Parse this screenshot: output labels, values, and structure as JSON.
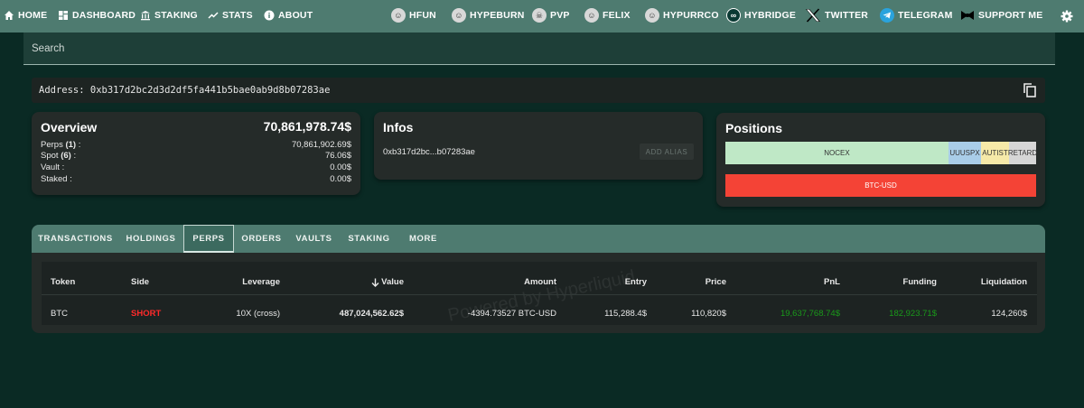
{
  "nav": {
    "home": "HOME",
    "dashboard": "DASHBOARD",
    "staking": "STAKING",
    "stats": "STATS",
    "about": "ABOUT",
    "hfun": "HFUN",
    "hypeburn": "HYPEBURN",
    "pvp": "PVP",
    "felix": "FELIX",
    "hypurrco": "HYPURRCO",
    "hybridge": "HYBRIDGE",
    "twitter": "TWITTER",
    "telegram": "TELEGRAM",
    "support": "SUPPORT ME"
  },
  "search": {
    "placeholder": "Search"
  },
  "address": {
    "text": "Address: 0xb317d2bc2d3d2df5fa441b5bae0ab9d8b07283ae"
  },
  "overview": {
    "title": "Overview",
    "total": "70,861,978.74$",
    "rows": [
      {
        "label": "Perps",
        "count": "(1)",
        "value": "70,861,902.69$"
      },
      {
        "label": "Spot",
        "count": "(6)",
        "value": "76.06$"
      },
      {
        "label": "Vault",
        "count": "",
        "value": "0.00$"
      },
      {
        "label": "Staked",
        "count": "",
        "value": "0.00$"
      }
    ]
  },
  "infos": {
    "title": "Infos",
    "address_short": "0xb317d2bc...b07283ae",
    "add_alias": "ADD ALIAS"
  },
  "positions": {
    "title": "Positions",
    "spot_segments": [
      "NOCEX",
      "UUUSPX",
      "AUTIST",
      "RETARD"
    ],
    "perp_segments": [
      "BTC-USD"
    ],
    "colors": {
      "nocex": "#bfe8c6",
      "uuuspx": "#a9cde8",
      "autist": "#f6e9a8",
      "retard": "#d6d6d6",
      "btc": "#f44336"
    }
  },
  "tabs": [
    "TRANSACTIONS",
    "HOLDINGS",
    "PERPS",
    "ORDERS",
    "VAULTS",
    "STAKING",
    "MORE"
  ],
  "active_tab": "PERPS",
  "table": {
    "headers": [
      "Token",
      "Side",
      "Leverage",
      "Value",
      "Amount",
      "Entry",
      "Price",
      "PnL",
      "Funding",
      "Liquidation"
    ],
    "rows": [
      {
        "token": "BTC",
        "side": "SHORT",
        "leverage": "10X (cross)",
        "value": "487,024,562.62$",
        "amount": "-4394.73527 BTC-USD",
        "entry": "115,288.4$",
        "price": "110,820$",
        "pnl": "19,637,768.74$",
        "funding": "182,923.71$",
        "liquidation": "124,260$"
      }
    ],
    "watermark": "Powered by Hyperliquid"
  },
  "colors": {
    "nav_bg": "#4e7b70",
    "page_bg": "#0a2a24",
    "card_bg": "#252b29",
    "short_red": "#ff2a2a",
    "profit_green": "#1a9a1a"
  }
}
